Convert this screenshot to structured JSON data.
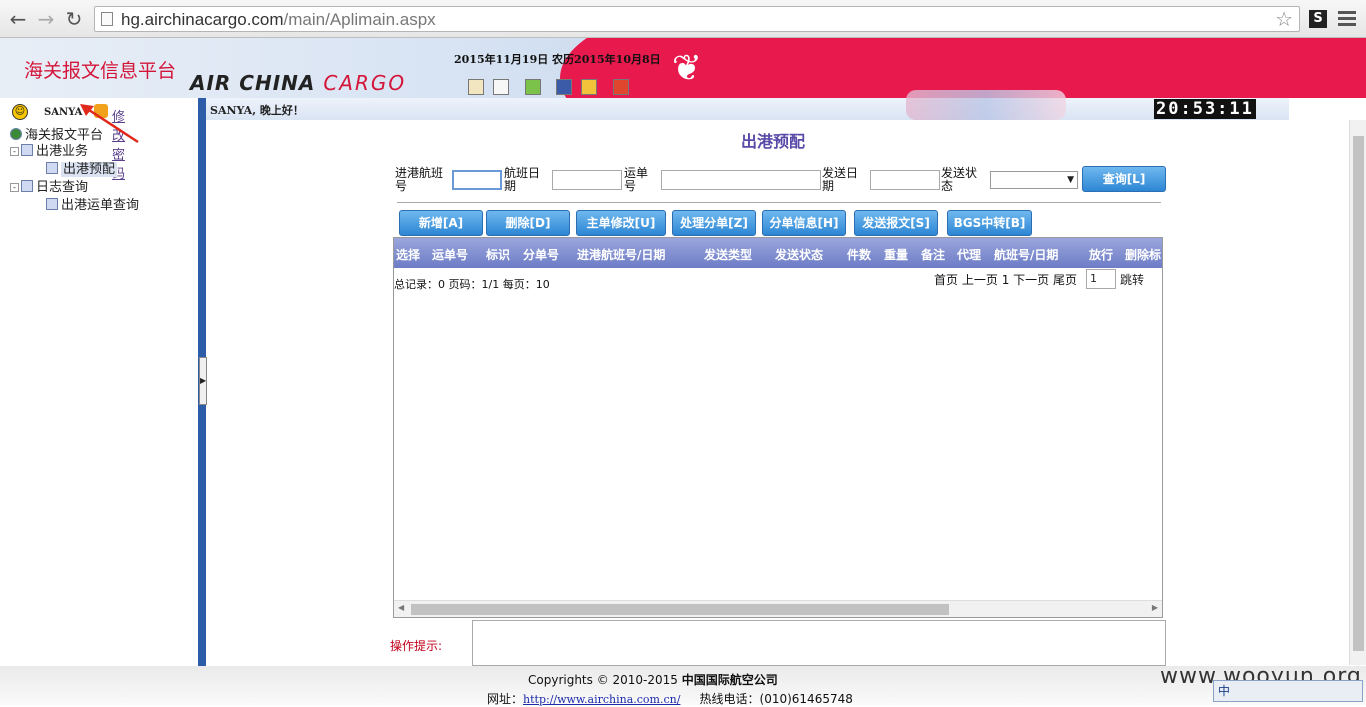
{
  "browser": {
    "url_host": "hg.airchinacargo.com",
    "url_path": "/main/Aplimain.aspx",
    "back_icon": "arrow-left-icon",
    "forward_icon": "arrow-right-icon",
    "reload_icon": "reload-icon",
    "ext_label": "S"
  },
  "banner": {
    "title": "海关报文信息平台",
    "logo_main": "AIR CHINA",
    "logo_cargo": "CARGO",
    "date": "2015年11月19日  农历2015年10月8日"
  },
  "sidebar": {
    "username": "SANYA",
    "change_password": "修改密码",
    "tree": {
      "root": "海关报文平台",
      "nodes": [
        {
          "label": "出港业务",
          "children": [
            "出港预配"
          ]
        },
        {
          "label": "日志查询",
          "children": [
            "出港运单查询"
          ]
        }
      ]
    }
  },
  "topbar": {
    "greeting": "SANYA, 晚上好！",
    "clock": "20:53:11"
  },
  "main": {
    "title": "出港预配",
    "filters": {
      "flight_in_label": "进港航班号",
      "flight_date_label": "航班日期",
      "waybill_label": "运单号",
      "send_date_label": "发送日期",
      "send_status_label": "发送状态",
      "query_button": "查询[L]"
    },
    "actions": [
      "新增[A]",
      "删除[D]",
      "主单修改[U]",
      "处理分单[Z]",
      "分单信息[H]",
      "发送报文[S]",
      "BGS中转[B]"
    ],
    "table": {
      "columns": [
        "选择",
        "运单号",
        "标识",
        "分单号",
        "进港航班号/日期",
        "发送类型",
        "发送状态",
        "件数",
        "重量",
        "备注",
        "代理",
        "航班号/日期",
        "放行",
        "删除标"
      ],
      "rows": []
    },
    "pager": {
      "summary": "总记录：0 页码：1/1 每页：10",
      "first": "首页",
      "prev": "上一页",
      "current": "1",
      "next": "下一页",
      "last": "尾页",
      "page_input": "1",
      "jump": "跳转"
    },
    "tip_label": "操作提示:"
  },
  "footer": {
    "copyright": "Copyrights © 2010-2015 ",
    "company": "中国国际航空公司",
    "site_label": "网址：",
    "site_url": "http://www.airchina.com.cn/",
    "hotline": "热线电话：(010)61465748"
  },
  "watermark": "www.wooyun.org",
  "ime": "中"
}
